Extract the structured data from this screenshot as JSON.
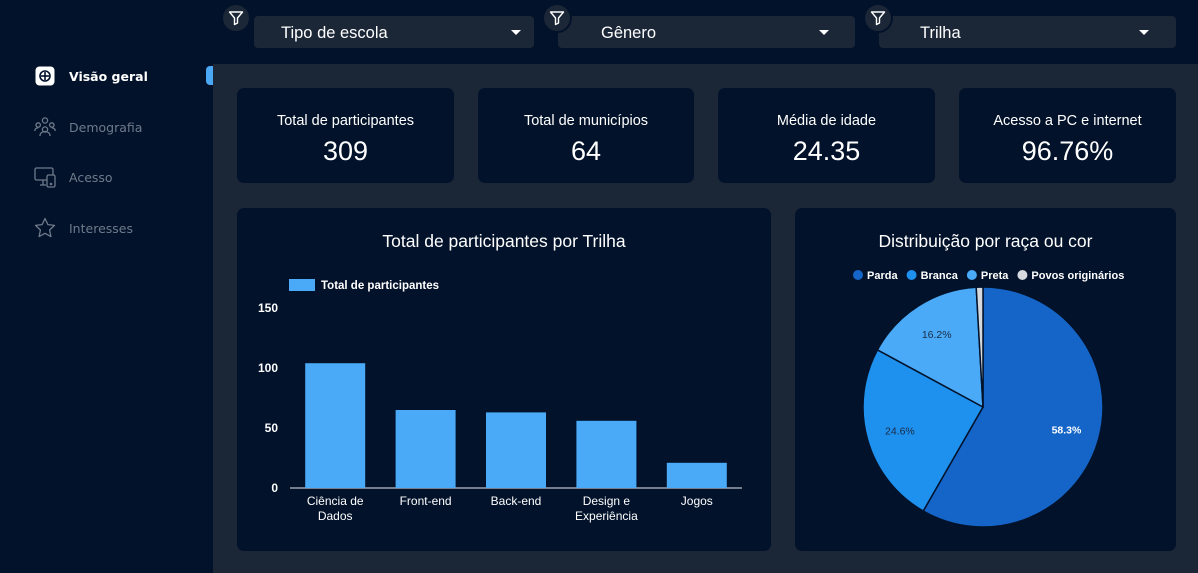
{
  "sidebar": {
    "items": [
      {
        "label": "Visão geral",
        "icon": "grid-icon",
        "active": true
      },
      {
        "label": "Demografia",
        "icon": "people-icon",
        "active": false
      },
      {
        "label": "Acesso",
        "icon": "devices-icon",
        "active": false
      },
      {
        "label": "Interesses",
        "icon": "star-icon",
        "active": false
      }
    ]
  },
  "filters": [
    {
      "label": "Tipo de escola",
      "icon": "filter-icon"
    },
    {
      "label": "Gênero",
      "icon": "filter-icon"
    },
    {
      "label": "Trilha",
      "icon": "filter-icon"
    }
  ],
  "kpis": [
    {
      "title": "Total de participantes",
      "value": "309"
    },
    {
      "title": "Total de municípios",
      "value": "64"
    },
    {
      "title": "Média de idade",
      "value": "24.35"
    },
    {
      "title": "Acesso a PC e internet",
      "value": "96.76%"
    }
  ],
  "colors": {
    "background": "#02122a",
    "panel": "#1b2637",
    "accent": "#4aa8f5"
  },
  "chart_data": [
    {
      "type": "bar",
      "title": "Total de participantes por Trilha",
      "categories": [
        "Ciência de Dados",
        "Front-end",
        "Back-end",
        "Design e Experiência",
        "Jogos"
      ],
      "category_lines": [
        [
          "Ciência de",
          "Dados"
        ],
        [
          "Front-end"
        ],
        [
          "Back-end"
        ],
        [
          "Design e",
          "Experiência"
        ],
        [
          "Jogos"
        ]
      ],
      "series": [
        {
          "name": "Total de participantes",
          "values": [
            104,
            65,
            63,
            56,
            21
          ],
          "color": "#4aaaf8"
        }
      ],
      "yticks": [
        "0",
        "50",
        "100",
        "150"
      ],
      "ylim": [
        0,
        150
      ],
      "legend": "top-left",
      "grid": false
    },
    {
      "type": "pie",
      "title": "Distribuição por raça ou cor",
      "slices": [
        {
          "label": "Parda",
          "value": 58.3,
          "display": "58.3%",
          "color": "#1565c8"
        },
        {
          "label": "Branca",
          "value": 24.6,
          "display": "24.6%",
          "color": "#1e90ee"
        },
        {
          "label": "Preta",
          "value": 16.2,
          "display": "16.2%",
          "color": "#4aaaf8"
        },
        {
          "label": "Povos originários",
          "value": 0.9,
          "display": "",
          "color": "#d6d9de"
        }
      ],
      "legend": "top"
    }
  ]
}
